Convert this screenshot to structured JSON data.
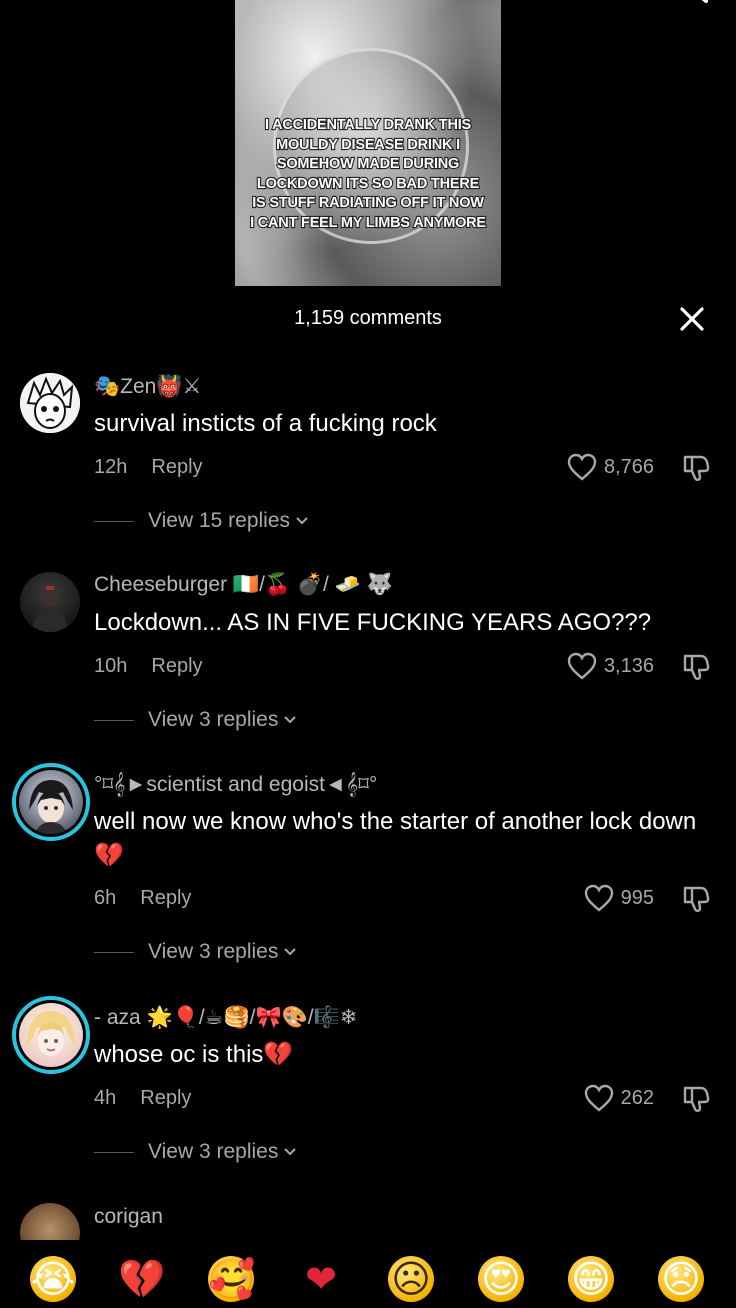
{
  "video": {
    "caption": "I ACCIDENTALLY DRANK THIS MOULDY DISEASE DRINK I SOMEHOW MADE DURING LOCKDOWN ITS SO BAD THERE IS STUFF RADIATING OFF IT NOW I CANT FEEL MY LIMBS ANYMORE"
  },
  "header": {
    "title": "1,159 comments",
    "close_icon": "close-icon",
    "search_icon": "search-icon"
  },
  "comments": [
    {
      "username": "🎭Zen👹⚔",
      "text": "survival insticts of a fucking rock",
      "time": "12h",
      "reply_label": "Reply",
      "likes": "8,766",
      "view_replies": "View 15 replies"
    },
    {
      "username": "Cheeseburger 🇮🇪/🍒 💣/ 🧈 🐺",
      "text": "Lockdown... AS IN FIVE FUCKING YEARS AGO???",
      "time": "10h",
      "reply_label": "Reply",
      "likes": "3,136",
      "view_replies": "View 3 replies"
    },
    {
      "username": "°⌑𝄞►scientist and egoist◄𝄞⌑°",
      "text": "well now we know who's the starter of another lock down 💔",
      "time": "6h",
      "reply_label": "Reply",
      "likes": "995",
      "view_replies": "View 3 replies"
    },
    {
      "username": "- aza 🌟🎈/☕🥞/🎀🎨/🎼❄",
      "text": "whose oc is this💔",
      "time": "4h",
      "reply_label": "Reply",
      "likes": "262",
      "view_replies": "View 3 replies"
    },
    {
      "username": "corigan"
    }
  ],
  "emoji_bar": [
    "😭",
    "💔",
    "🥰",
    "❤",
    "☹",
    "😍",
    "😁",
    "😞"
  ],
  "colors": {
    "background": "#000000",
    "ring": "#27c5e0",
    "secondary_text": "#a8a8a8"
  }
}
